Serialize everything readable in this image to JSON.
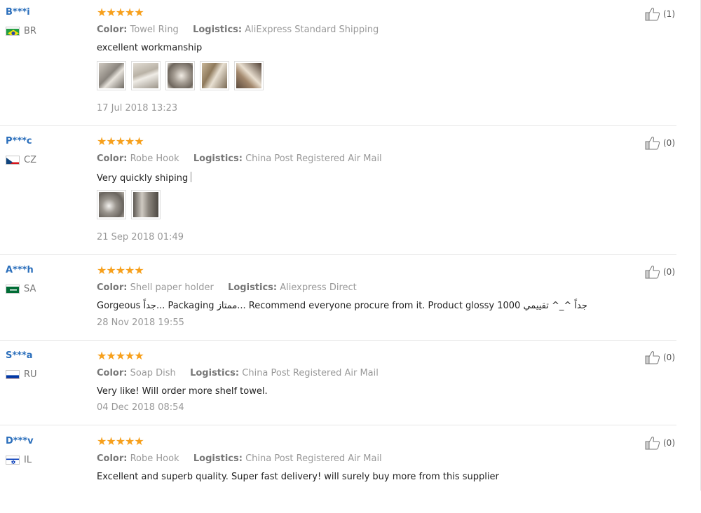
{
  "reviews": [
    {
      "username": "B***i",
      "country": "BR",
      "flag": "brazil-flag",
      "rating": "★★★★★",
      "color_label": "Color:",
      "color_value": "Towel Ring",
      "logistics_label": "Logistics:",
      "logistics_value": "AliExpress Standard Shipping",
      "text": "excellent workmanship",
      "photos": 5,
      "date": "17 Jul 2018 13:23",
      "likes": "(1)"
    },
    {
      "username": "P***c",
      "country": "CZ",
      "flag": "czech-flag",
      "rating": "★★★★★",
      "color_label": "Color:",
      "color_value": "Robe Hook",
      "logistics_label": "Logistics:",
      "logistics_value": "China Post Registered Air Mail",
      "text": "Very quickly shiping",
      "photos": 2,
      "date": "21 Sep 2018 01:49",
      "likes": "(0)"
    },
    {
      "username": "A***h",
      "country": "SA",
      "flag": "saudi-flag",
      "rating": "★★★★★",
      "color_label": "Color:",
      "color_value": "Shell paper holder",
      "logistics_label": "Logistics:",
      "logistics_value": "Aliexpress Direct",
      "text": "Gorgeous جداً... Packaging ممتاز... Recommend everyone procure from it. Product glossy 1000 جداً ^_^ تقييمي",
      "photos": 0,
      "date": "28 Nov 2018 19:55",
      "likes": "(0)"
    },
    {
      "username": "S***a",
      "country": "RU",
      "flag": "russia-flag",
      "rating": "★★★★★",
      "color_label": "Color:",
      "color_value": "Soap Dish",
      "logistics_label": "Logistics:",
      "logistics_value": "China Post Registered Air Mail",
      "text": "Very like! Will order more shelf towel.",
      "photos": 0,
      "date": "04 Dec 2018 08:54",
      "likes": "(0)"
    },
    {
      "username": "D***v",
      "country": "IL",
      "flag": "israel-flag",
      "rating": "★★★★★",
      "color_label": "Color:",
      "color_value": "Robe Hook",
      "logistics_label": "Logistics:",
      "logistics_value": "China Post Registered Air Mail",
      "text": "Excellent and superb quality. Super fast delivery! will surely buy more from this supplier",
      "photos": 0,
      "date": "",
      "likes": "(0)"
    }
  ]
}
